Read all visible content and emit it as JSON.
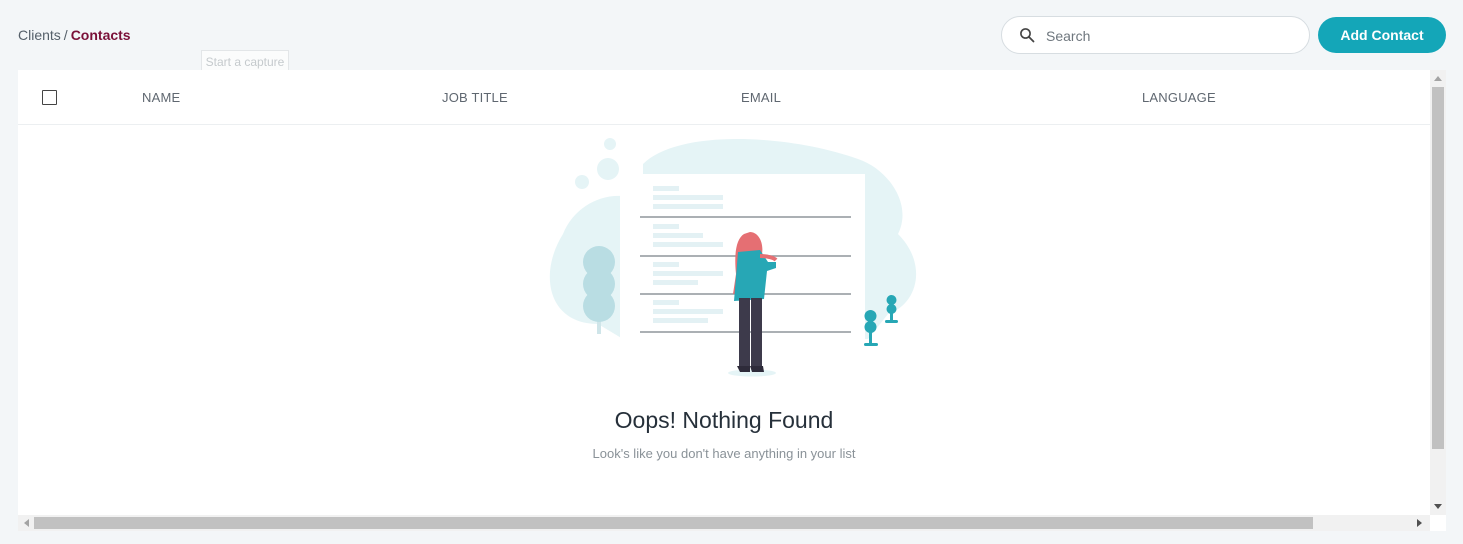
{
  "breadcrumb": {
    "parent": "Clients",
    "separator": "/",
    "current": "Contacts"
  },
  "tooltip": {
    "text": "Start a capture"
  },
  "search": {
    "placeholder": "Search",
    "value": "",
    "icon": "search-icon"
  },
  "actions": {
    "add_contact_label": "Add Contact"
  },
  "table": {
    "columns": [
      "NAME",
      "JOB TITLE",
      "EMAIL",
      "LANGUAGE"
    ],
    "rows": []
  },
  "empty_state": {
    "title": "Oops! Nothing Found",
    "subtitle": "Look's like you don't have anything in your list"
  },
  "colors": {
    "accent": "#14a6b8",
    "breadcrumb_current": "#7a1038",
    "background": "#f3f6f8",
    "illustration_light": "#e5f4f6",
    "illustration_teal": "#27a7b5",
    "figure_hair": "#e56f73"
  }
}
